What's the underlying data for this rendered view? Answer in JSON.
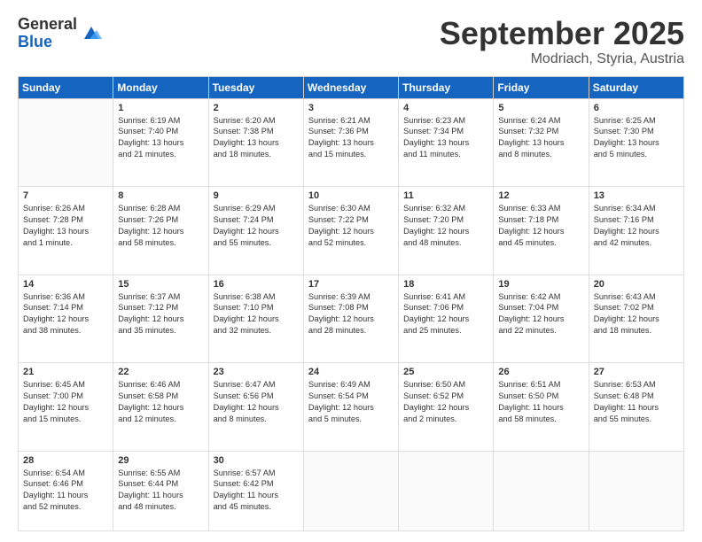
{
  "header": {
    "logo_general": "General",
    "logo_blue": "Blue",
    "month_title": "September 2025",
    "location": "Modriach, Styria, Austria"
  },
  "weekdays": [
    "Sunday",
    "Monday",
    "Tuesday",
    "Wednesday",
    "Thursday",
    "Friday",
    "Saturday"
  ],
  "weeks": [
    [
      {
        "day": "",
        "info": ""
      },
      {
        "day": "1",
        "info": "Sunrise: 6:19 AM\nSunset: 7:40 PM\nDaylight: 13 hours\nand 21 minutes."
      },
      {
        "day": "2",
        "info": "Sunrise: 6:20 AM\nSunset: 7:38 PM\nDaylight: 13 hours\nand 18 minutes."
      },
      {
        "day": "3",
        "info": "Sunrise: 6:21 AM\nSunset: 7:36 PM\nDaylight: 13 hours\nand 15 minutes."
      },
      {
        "day": "4",
        "info": "Sunrise: 6:23 AM\nSunset: 7:34 PM\nDaylight: 13 hours\nand 11 minutes."
      },
      {
        "day": "5",
        "info": "Sunrise: 6:24 AM\nSunset: 7:32 PM\nDaylight: 13 hours\nand 8 minutes."
      },
      {
        "day": "6",
        "info": "Sunrise: 6:25 AM\nSunset: 7:30 PM\nDaylight: 13 hours\nand 5 minutes."
      }
    ],
    [
      {
        "day": "7",
        "info": "Sunrise: 6:26 AM\nSunset: 7:28 PM\nDaylight: 13 hours\nand 1 minute."
      },
      {
        "day": "8",
        "info": "Sunrise: 6:28 AM\nSunset: 7:26 PM\nDaylight: 12 hours\nand 58 minutes."
      },
      {
        "day": "9",
        "info": "Sunrise: 6:29 AM\nSunset: 7:24 PM\nDaylight: 12 hours\nand 55 minutes."
      },
      {
        "day": "10",
        "info": "Sunrise: 6:30 AM\nSunset: 7:22 PM\nDaylight: 12 hours\nand 52 minutes."
      },
      {
        "day": "11",
        "info": "Sunrise: 6:32 AM\nSunset: 7:20 PM\nDaylight: 12 hours\nand 48 minutes."
      },
      {
        "day": "12",
        "info": "Sunrise: 6:33 AM\nSunset: 7:18 PM\nDaylight: 12 hours\nand 45 minutes."
      },
      {
        "day": "13",
        "info": "Sunrise: 6:34 AM\nSunset: 7:16 PM\nDaylight: 12 hours\nand 42 minutes."
      }
    ],
    [
      {
        "day": "14",
        "info": "Sunrise: 6:36 AM\nSunset: 7:14 PM\nDaylight: 12 hours\nand 38 minutes."
      },
      {
        "day": "15",
        "info": "Sunrise: 6:37 AM\nSunset: 7:12 PM\nDaylight: 12 hours\nand 35 minutes."
      },
      {
        "day": "16",
        "info": "Sunrise: 6:38 AM\nSunset: 7:10 PM\nDaylight: 12 hours\nand 32 minutes."
      },
      {
        "day": "17",
        "info": "Sunrise: 6:39 AM\nSunset: 7:08 PM\nDaylight: 12 hours\nand 28 minutes."
      },
      {
        "day": "18",
        "info": "Sunrise: 6:41 AM\nSunset: 7:06 PM\nDaylight: 12 hours\nand 25 minutes."
      },
      {
        "day": "19",
        "info": "Sunrise: 6:42 AM\nSunset: 7:04 PM\nDaylight: 12 hours\nand 22 minutes."
      },
      {
        "day": "20",
        "info": "Sunrise: 6:43 AM\nSunset: 7:02 PM\nDaylight: 12 hours\nand 18 minutes."
      }
    ],
    [
      {
        "day": "21",
        "info": "Sunrise: 6:45 AM\nSunset: 7:00 PM\nDaylight: 12 hours\nand 15 minutes."
      },
      {
        "day": "22",
        "info": "Sunrise: 6:46 AM\nSunset: 6:58 PM\nDaylight: 12 hours\nand 12 minutes."
      },
      {
        "day": "23",
        "info": "Sunrise: 6:47 AM\nSunset: 6:56 PM\nDaylight: 12 hours\nand 8 minutes."
      },
      {
        "day": "24",
        "info": "Sunrise: 6:49 AM\nSunset: 6:54 PM\nDaylight: 12 hours\nand 5 minutes."
      },
      {
        "day": "25",
        "info": "Sunrise: 6:50 AM\nSunset: 6:52 PM\nDaylight: 12 hours\nand 2 minutes."
      },
      {
        "day": "26",
        "info": "Sunrise: 6:51 AM\nSunset: 6:50 PM\nDaylight: 11 hours\nand 58 minutes."
      },
      {
        "day": "27",
        "info": "Sunrise: 6:53 AM\nSunset: 6:48 PM\nDaylight: 11 hours\nand 55 minutes."
      }
    ],
    [
      {
        "day": "28",
        "info": "Sunrise: 6:54 AM\nSunset: 6:46 PM\nDaylight: 11 hours\nand 52 minutes."
      },
      {
        "day": "29",
        "info": "Sunrise: 6:55 AM\nSunset: 6:44 PM\nDaylight: 11 hours\nand 48 minutes."
      },
      {
        "day": "30",
        "info": "Sunrise: 6:57 AM\nSunset: 6:42 PM\nDaylight: 11 hours\nand 45 minutes."
      },
      {
        "day": "",
        "info": ""
      },
      {
        "day": "",
        "info": ""
      },
      {
        "day": "",
        "info": ""
      },
      {
        "day": "",
        "info": ""
      }
    ]
  ]
}
